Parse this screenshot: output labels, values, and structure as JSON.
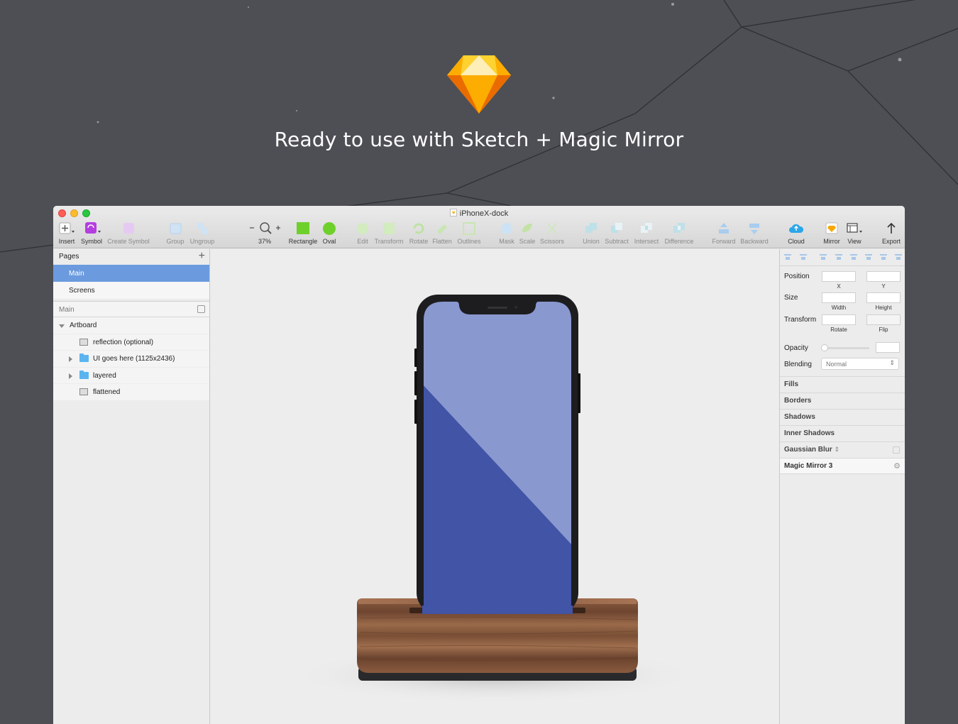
{
  "headline": "Ready to use with Sketch + Magic Mirror",
  "window": {
    "title": "iPhoneX-dock"
  },
  "toolbar": {
    "insert": "Insert",
    "symbol": "Symbol",
    "create_symbol": "Create Symbol",
    "group": "Group",
    "ungroup": "Ungroup",
    "zoom_minus": "-",
    "zoom_plus": "+",
    "zoom_level": "37%",
    "rectangle": "Rectangle",
    "oval": "Oval",
    "edit": "Edit",
    "transform": "Transform",
    "rotate": "Rotate",
    "flatten": "Flatten",
    "outlines": "Outlines",
    "mask": "Mask",
    "scale": "Scale",
    "scissors": "Scissors",
    "union": "Union",
    "subtract": "Subtract",
    "intersect": "Intersect",
    "difference": "Difference",
    "forward": "Forward",
    "backward": "Backward",
    "cloud": "Cloud",
    "mirror": "Mirror",
    "view": "View",
    "export": "Export"
  },
  "sidebar": {
    "pages_label": "Pages",
    "pages": [
      "Main",
      "Screens"
    ],
    "layers_filter": "Main",
    "layers": [
      {
        "name": "Artboard"
      },
      {
        "name": "reflection (optional)"
      },
      {
        "name": "UI goes here (1125x2436)"
      },
      {
        "name": "layered"
      },
      {
        "name": "flattened"
      }
    ]
  },
  "inspector": {
    "position": "Position",
    "x": "X",
    "y": "Y",
    "size": "Size",
    "width": "Width",
    "height": "Height",
    "transform": "Transform",
    "rotate": "Rotate",
    "flip": "Flip",
    "opacity": "Opacity",
    "blending": "Blending",
    "blending_value": "Normal",
    "sections": [
      "Fills",
      "Borders",
      "Shadows",
      "Inner Shadows",
      "Gaussian Blur",
      "Magic Mirror 3"
    ]
  },
  "colors": {
    "background": "#4d4f54",
    "selection": "#6b9bde",
    "screen_blue": "#4154a6",
    "wood": "#7a4f35"
  }
}
